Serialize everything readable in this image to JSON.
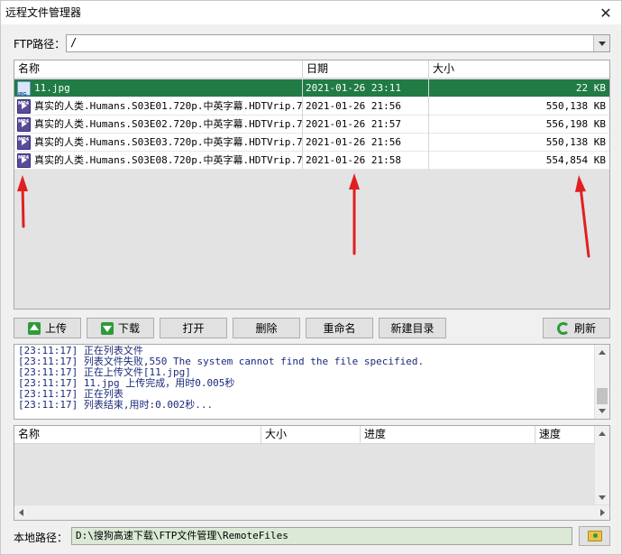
{
  "window": {
    "title": "远程文件管理器"
  },
  "ftp": {
    "label": "FTP路径：",
    "path": "/"
  },
  "remote_list": {
    "columns": [
      "名称",
      "日期",
      "大小"
    ],
    "rows": [
      {
        "name": "11.jpg",
        "date": "2021-01-26 23:11",
        "size": "22 KB",
        "type": "jpg-icon",
        "selected": true
      },
      {
        "name": "真实的人类.Humans.S03E01.720p.中英字幕.HDTVrip.7",
        "date": "2021-01-26 21:56",
        "size": "550,138 KB",
        "type": "mp4-icon",
        "selected": false
      },
      {
        "name": "真实的人类.Humans.S03E02.720p.中英字幕.HDTVrip.7",
        "date": "2021-01-26 21:57",
        "size": "556,198 KB",
        "type": "mp4-icon",
        "selected": false
      },
      {
        "name": "真实的人类.Humans.S03E03.720p.中英字幕.HDTVrip.7",
        "date": "2021-01-26 21:56",
        "size": "550,138 KB",
        "type": "mp4-icon",
        "selected": false
      },
      {
        "name": "真实的人类.Humans.S03E08.720p.中英字幕.HDTVrip.7",
        "date": "2021-01-26 21:58",
        "size": "554,854 KB",
        "type": "mp4-icon",
        "selected": false
      }
    ]
  },
  "toolbar": {
    "upload": "上传",
    "download": "下载",
    "open": "打开",
    "delete": "删除",
    "rename": "重命名",
    "new_dir": "新建目录",
    "refresh": "刷新"
  },
  "log": [
    "[23:11:17] 正在列表文件",
    "[23:11:17] 列表文件失败,550 The system cannot find the file specified.",
    "[23:11:17] 正在上传文件[11.jpg]",
    "[23:11:17] 11.jpg 上传完成，用时0.005秒",
    "[23:11:17] 正在列表",
    "[23:11:17] 列表结束,用时:0.002秒..."
  ],
  "transfer_list": {
    "columns": [
      "名称",
      "大小",
      "进度",
      "速度"
    ]
  },
  "local": {
    "label": "本地路径：",
    "path": "D:\\搜狗高速下载\\FTP文件管理\\RemoteFiles"
  },
  "colors": {
    "selection": "#207b44",
    "annotation_arrow": "#e02020",
    "log_text": "#1b2a7a"
  }
}
